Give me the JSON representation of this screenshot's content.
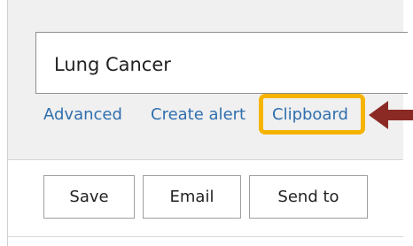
{
  "search": {
    "query": "Lung Cancer"
  },
  "links": {
    "advanced": "Advanced",
    "create_alert": "Create alert",
    "clipboard": "Clipboard"
  },
  "actions": {
    "save": "Save",
    "email": "Email",
    "send_to": "Send to"
  },
  "colors": {
    "link": "#2f6fae",
    "highlight": "#f5b400",
    "arrow": "#8b2a24",
    "panel": "#f0f0f0"
  }
}
